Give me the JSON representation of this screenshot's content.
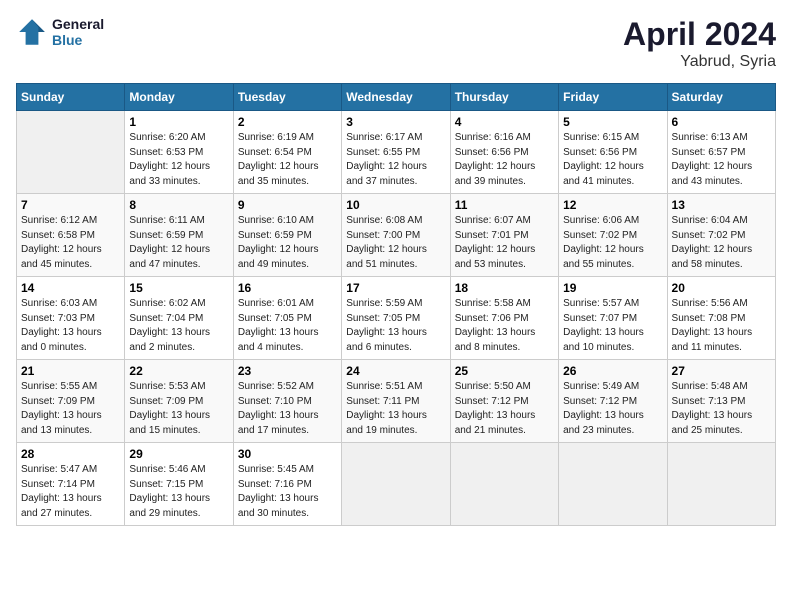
{
  "header": {
    "logo_line1": "General",
    "logo_line2": "Blue",
    "title": "April 2024",
    "subtitle": "Yabrud, Syria"
  },
  "weekdays": [
    "Sunday",
    "Monday",
    "Tuesday",
    "Wednesday",
    "Thursday",
    "Friday",
    "Saturday"
  ],
  "weeks": [
    [
      {
        "day": "",
        "info": ""
      },
      {
        "day": "1",
        "info": "Sunrise: 6:20 AM\nSunset: 6:53 PM\nDaylight: 12 hours\nand 33 minutes."
      },
      {
        "day": "2",
        "info": "Sunrise: 6:19 AM\nSunset: 6:54 PM\nDaylight: 12 hours\nand 35 minutes."
      },
      {
        "day": "3",
        "info": "Sunrise: 6:17 AM\nSunset: 6:55 PM\nDaylight: 12 hours\nand 37 minutes."
      },
      {
        "day": "4",
        "info": "Sunrise: 6:16 AM\nSunset: 6:56 PM\nDaylight: 12 hours\nand 39 minutes."
      },
      {
        "day": "5",
        "info": "Sunrise: 6:15 AM\nSunset: 6:56 PM\nDaylight: 12 hours\nand 41 minutes."
      },
      {
        "day": "6",
        "info": "Sunrise: 6:13 AM\nSunset: 6:57 PM\nDaylight: 12 hours\nand 43 minutes."
      }
    ],
    [
      {
        "day": "7",
        "info": "Sunrise: 6:12 AM\nSunset: 6:58 PM\nDaylight: 12 hours\nand 45 minutes."
      },
      {
        "day": "8",
        "info": "Sunrise: 6:11 AM\nSunset: 6:59 PM\nDaylight: 12 hours\nand 47 minutes."
      },
      {
        "day": "9",
        "info": "Sunrise: 6:10 AM\nSunset: 6:59 PM\nDaylight: 12 hours\nand 49 minutes."
      },
      {
        "day": "10",
        "info": "Sunrise: 6:08 AM\nSunset: 7:00 PM\nDaylight: 12 hours\nand 51 minutes."
      },
      {
        "day": "11",
        "info": "Sunrise: 6:07 AM\nSunset: 7:01 PM\nDaylight: 12 hours\nand 53 minutes."
      },
      {
        "day": "12",
        "info": "Sunrise: 6:06 AM\nSunset: 7:02 PM\nDaylight: 12 hours\nand 55 minutes."
      },
      {
        "day": "13",
        "info": "Sunrise: 6:04 AM\nSunset: 7:02 PM\nDaylight: 12 hours\nand 58 minutes."
      }
    ],
    [
      {
        "day": "14",
        "info": "Sunrise: 6:03 AM\nSunset: 7:03 PM\nDaylight: 13 hours\nand 0 minutes."
      },
      {
        "day": "15",
        "info": "Sunrise: 6:02 AM\nSunset: 7:04 PM\nDaylight: 13 hours\nand 2 minutes."
      },
      {
        "day": "16",
        "info": "Sunrise: 6:01 AM\nSunset: 7:05 PM\nDaylight: 13 hours\nand 4 minutes."
      },
      {
        "day": "17",
        "info": "Sunrise: 5:59 AM\nSunset: 7:05 PM\nDaylight: 13 hours\nand 6 minutes."
      },
      {
        "day": "18",
        "info": "Sunrise: 5:58 AM\nSunset: 7:06 PM\nDaylight: 13 hours\nand 8 minutes."
      },
      {
        "day": "19",
        "info": "Sunrise: 5:57 AM\nSunset: 7:07 PM\nDaylight: 13 hours\nand 10 minutes."
      },
      {
        "day": "20",
        "info": "Sunrise: 5:56 AM\nSunset: 7:08 PM\nDaylight: 13 hours\nand 11 minutes."
      }
    ],
    [
      {
        "day": "21",
        "info": "Sunrise: 5:55 AM\nSunset: 7:09 PM\nDaylight: 13 hours\nand 13 minutes."
      },
      {
        "day": "22",
        "info": "Sunrise: 5:53 AM\nSunset: 7:09 PM\nDaylight: 13 hours\nand 15 minutes."
      },
      {
        "day": "23",
        "info": "Sunrise: 5:52 AM\nSunset: 7:10 PM\nDaylight: 13 hours\nand 17 minutes."
      },
      {
        "day": "24",
        "info": "Sunrise: 5:51 AM\nSunset: 7:11 PM\nDaylight: 13 hours\nand 19 minutes."
      },
      {
        "day": "25",
        "info": "Sunrise: 5:50 AM\nSunset: 7:12 PM\nDaylight: 13 hours\nand 21 minutes."
      },
      {
        "day": "26",
        "info": "Sunrise: 5:49 AM\nSunset: 7:12 PM\nDaylight: 13 hours\nand 23 minutes."
      },
      {
        "day": "27",
        "info": "Sunrise: 5:48 AM\nSunset: 7:13 PM\nDaylight: 13 hours\nand 25 minutes."
      }
    ],
    [
      {
        "day": "28",
        "info": "Sunrise: 5:47 AM\nSunset: 7:14 PM\nDaylight: 13 hours\nand 27 minutes."
      },
      {
        "day": "29",
        "info": "Sunrise: 5:46 AM\nSunset: 7:15 PM\nDaylight: 13 hours\nand 29 minutes."
      },
      {
        "day": "30",
        "info": "Sunrise: 5:45 AM\nSunset: 7:16 PM\nDaylight: 13 hours\nand 30 minutes."
      },
      {
        "day": "",
        "info": ""
      },
      {
        "day": "",
        "info": ""
      },
      {
        "day": "",
        "info": ""
      },
      {
        "day": "",
        "info": ""
      }
    ]
  ]
}
